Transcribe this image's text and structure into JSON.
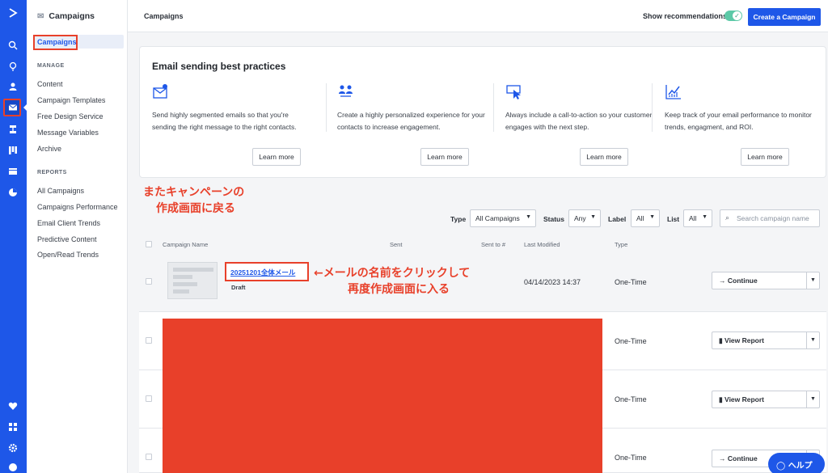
{
  "topbar": {
    "title": "Campaigns",
    "show_recommendations": "Show recommendations",
    "create_button": "Create a Campaign"
  },
  "sidebar": {
    "header": "Campaigns",
    "active_item": "Campaigns",
    "manage_heading": "MANAGE",
    "manage_items": [
      "Content",
      "Campaign Templates",
      "Free Design Service",
      "Message Variables",
      "Archive"
    ],
    "reports_heading": "REPORTS",
    "reports_items": [
      "All Campaigns",
      "Campaigns Performance",
      "Email Client Trends",
      "Predictive Content",
      "Open/Read Trends"
    ]
  },
  "best_practices": {
    "title": "Email sending best practices",
    "cards": [
      {
        "icon": "email-check-icon",
        "text": "Send highly segmented emails so that you're sending the right message to the right contacts.",
        "button": "Learn more"
      },
      {
        "icon": "people-icon",
        "text": "Create a highly personalized experience for your contacts to increase engagement.",
        "button": "Learn more"
      },
      {
        "icon": "cursor-click-icon",
        "text": "Always include a call-to-action so your customer engages with the next step.",
        "button": "Learn more"
      },
      {
        "icon": "chart-up-icon",
        "text": "Keep track of your email performance to monitor trends, engagment, and ROI.",
        "button": "Learn more"
      }
    ]
  },
  "annotations": {
    "back_line1": "またキャンペーンの",
    "back_line2": "作成画面に戻る",
    "click_line1": "←メールの名前をクリックして",
    "click_line2": "再度作成画面に入る"
  },
  "filters": {
    "type_label": "Type",
    "type_value": "All Campaigns",
    "status_label": "Status",
    "status_value": "Any",
    "label_label": "Label",
    "label_value": "All",
    "list_label": "List",
    "list_value": "All",
    "search_placeholder": "Search campaign name"
  },
  "table": {
    "headers": {
      "name": "Campaign Name",
      "sent": "Sent",
      "sent_to": "Sent to #",
      "modified": "Last Modified",
      "type": "Type"
    },
    "rows": [
      {
        "name": "20251201全体メール",
        "status": "Draft",
        "modified": "04/14/2023 14:37",
        "type": "One-Time",
        "action": "Continue",
        "action_icon": "arrow-right-icon"
      },
      {
        "type": "One-Time",
        "action": "View Report",
        "action_icon": "bar-chart-icon"
      },
      {
        "type": "One-Time",
        "action": "View Report",
        "action_icon": "bar-chart-icon"
      },
      {
        "type": "One-Time",
        "action": "Continue",
        "action_icon": "arrow-right-icon"
      }
    ]
  },
  "help": {
    "label": "ヘルプ"
  },
  "colors": {
    "brand": "#1e57e8",
    "annotation": "#e8402a",
    "toggle": "#5cc9a7"
  }
}
